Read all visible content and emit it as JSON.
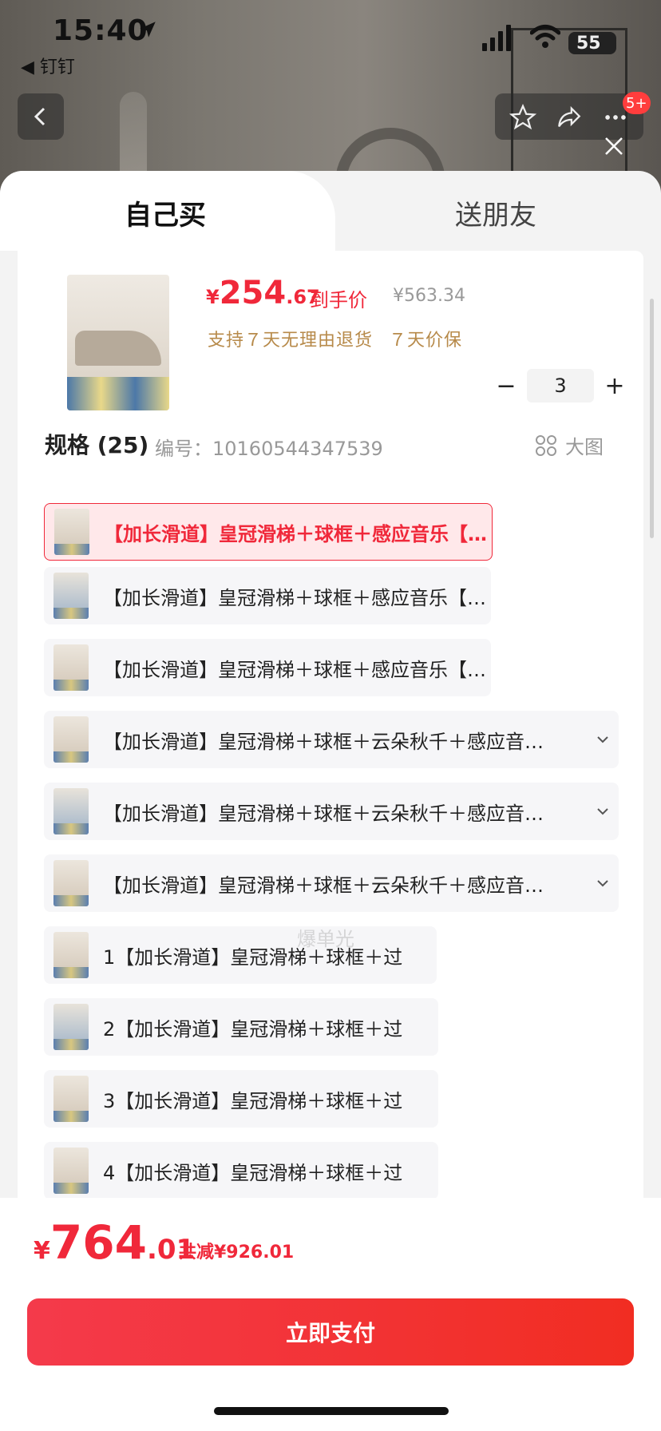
{
  "status_bar": {
    "time": "15:40",
    "back_app": "◀ 钉钉",
    "battery": "55"
  },
  "nav": {
    "cart_badge": "5+"
  },
  "tabs": [
    {
      "label": "自己买"
    },
    {
      "label": "送朋友"
    }
  ],
  "product": {
    "price_symbol": "¥",
    "price_int": "254",
    "price_dec": ".67",
    "price_tag": "到手价",
    "original_price": "¥563.34",
    "services": [
      "支持７天无理由退货",
      "７天价保"
    ],
    "quantity": "3",
    "minus_label": "−",
    "plus_label": "+"
  },
  "spec": {
    "title": "规格 (25)",
    "code": "编号：10160544347539",
    "big_view_label": "大图",
    "options": [
      {
        "label": "【加长滑道】皇冠滑梯＋球框＋感应音乐【灰白】",
        "selected": true
      },
      {
        "label": "【加长滑道】皇冠滑梯＋球框＋感应音乐【蓝黄】"
      },
      {
        "label": "【加长滑道】皇冠滑梯＋球框＋感应音乐【卡其】"
      },
      {
        "label": "【加长滑道】皇冠滑梯＋球框＋云朵秋千＋感应音…",
        "expandable": true
      },
      {
        "label": "【加长滑道】皇冠滑梯＋球框＋云朵秋千＋感应音…",
        "expandable": true
      },
      {
        "label": "【加长滑道】皇冠滑梯＋球框＋云朵秋千＋感应音…",
        "expandable": true
      },
      {
        "label": "1【加长滑道】皇冠滑梯＋球框＋过"
      },
      {
        "label": "2【加长滑道】皇冠滑梯＋球框＋过"
      },
      {
        "label": "3【加长滑道】皇冠滑梯＋球框＋过"
      },
      {
        "label": "4【加长滑道】皇冠滑梯＋球框＋过"
      }
    ]
  },
  "watermark": "爆单光",
  "footer": {
    "total_symbol": "¥",
    "total_int": "764",
    "total_dec": ".01",
    "savings": "共减¥926.01",
    "pay_button": "立即支付"
  },
  "colors": {
    "accent": "#f0283a",
    "service": "#b78a4a"
  }
}
